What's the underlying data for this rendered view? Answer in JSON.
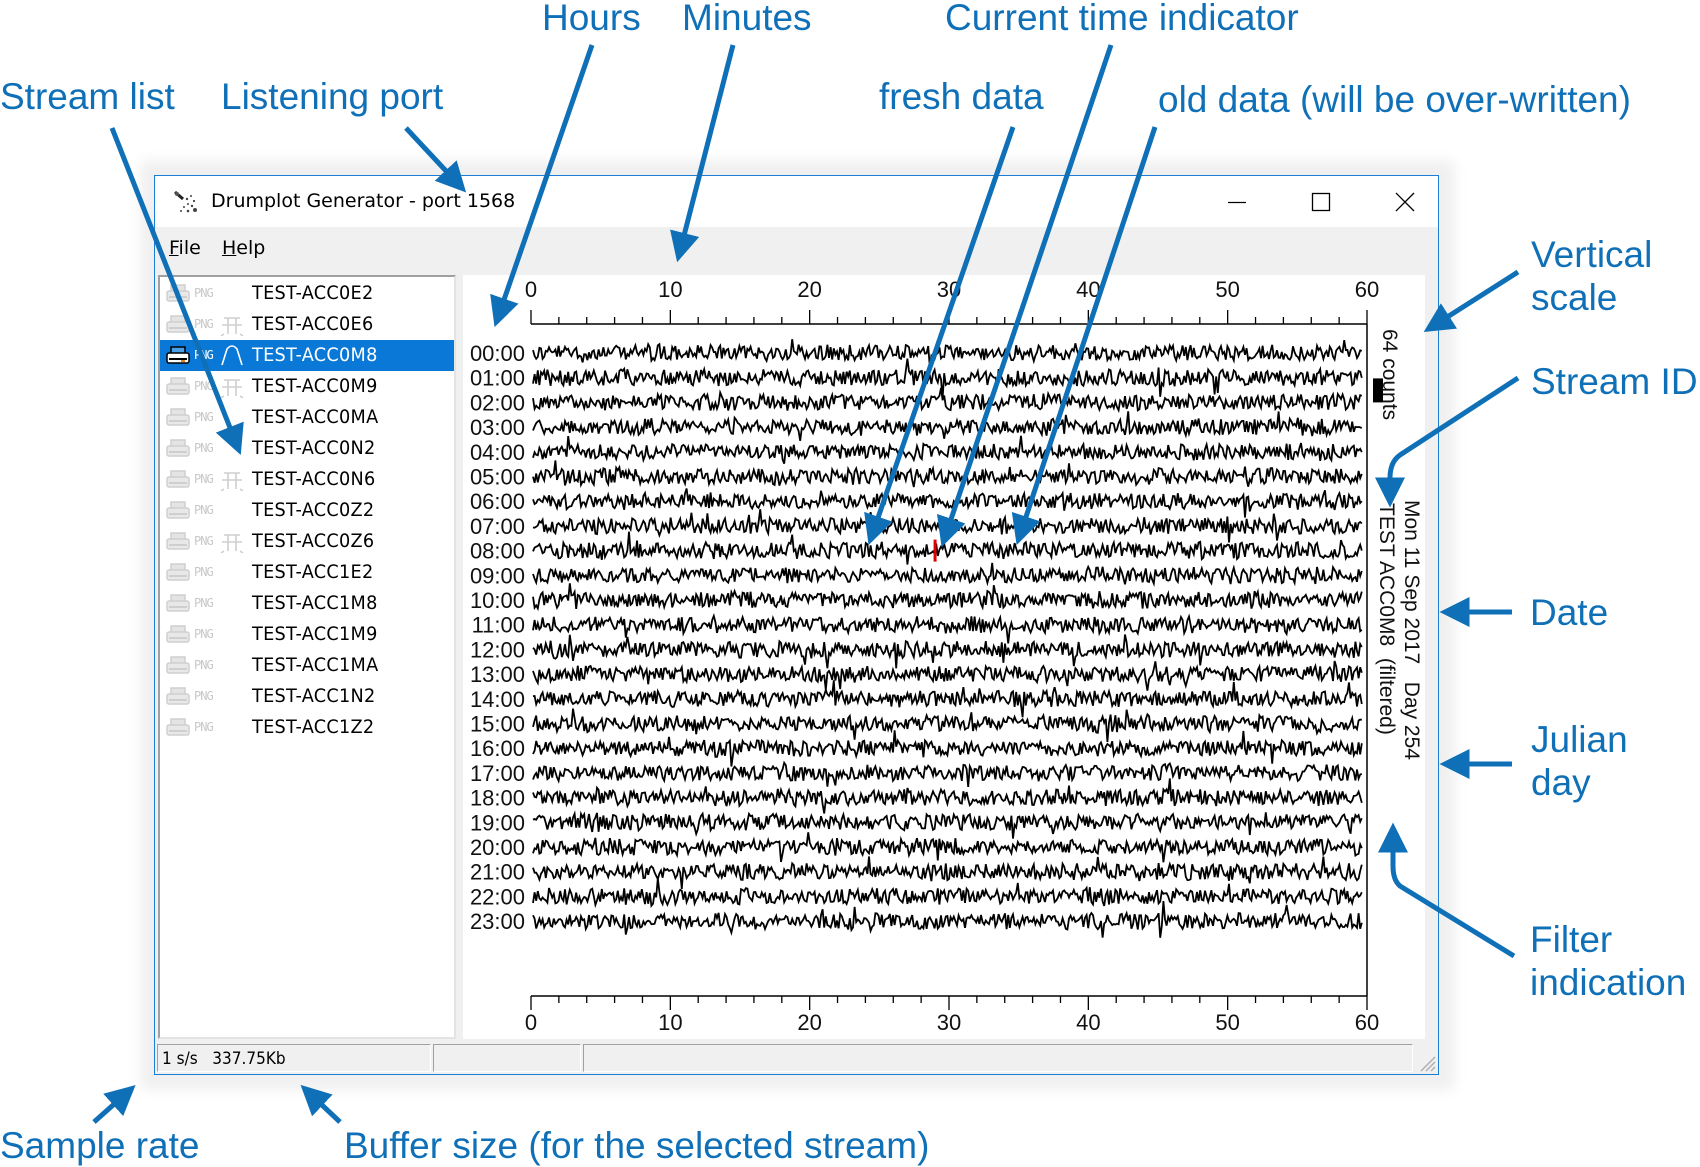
{
  "annotations": {
    "hours": "Hours",
    "minutes": "Minutes",
    "current_time_indicator": "Current time indicator",
    "stream_list": "Stream list",
    "listening_port": "Listening port",
    "fresh_data": "fresh data",
    "old_data": "old data (will be over-written)",
    "vertical_scale_line1": "Vertical",
    "vertical_scale_line2": "scale",
    "stream_id": "Stream ID",
    "date": "Date",
    "julian_day_line1": "Julian",
    "julian_day_line2": "day",
    "filter_indication_line1": "Filter",
    "filter_indication_line2": "indication",
    "sample_rate": "Sample rate",
    "buffer_size": "Buffer size (for the selected stream)"
  },
  "window": {
    "title": "Drumplot Generator - port 1568",
    "icon": "drumplot-app-icon",
    "controls": {
      "minimize": "minimize-icon",
      "maximize": "maximize-icon",
      "close": "close-icon"
    }
  },
  "menu": [
    {
      "label_mnemonic": "F",
      "label_rest": "ile"
    },
    {
      "label_mnemonic": "H",
      "label_rest": "elp"
    }
  ],
  "streams": [
    {
      "name": "TEST-ACC0E2",
      "png": "PNG",
      "filter": false,
      "selected": false
    },
    {
      "name": "TEST-ACC0E6",
      "png": "PNG",
      "filter": true,
      "selected": false
    },
    {
      "name": "TEST-ACC0M8",
      "png": "PNG",
      "filter": true,
      "selected": true
    },
    {
      "name": "TEST-ACC0M9",
      "png": "PNG",
      "filter": true,
      "selected": false
    },
    {
      "name": "TEST-ACC0MA",
      "png": "PNG",
      "filter": false,
      "selected": false
    },
    {
      "name": "TEST-ACC0N2",
      "png": "PNG",
      "filter": false,
      "selected": false
    },
    {
      "name": "TEST-ACC0N6",
      "png": "PNG",
      "filter": true,
      "selected": false
    },
    {
      "name": "TEST-ACC0Z2",
      "png": "PNG",
      "filter": false,
      "selected": false
    },
    {
      "name": "TEST-ACC0Z6",
      "png": "PNG",
      "filter": true,
      "selected": false
    },
    {
      "name": "TEST-ACC1E2",
      "png": "PNG",
      "filter": false,
      "selected": false
    },
    {
      "name": "TEST-ACC1M8",
      "png": "PNG",
      "filter": false,
      "selected": false
    },
    {
      "name": "TEST-ACC1M9",
      "png": "PNG",
      "filter": false,
      "selected": false
    },
    {
      "name": "TEST-ACC1MA",
      "png": "PNG",
      "filter": false,
      "selected": false
    },
    {
      "name": "TEST-ACC1N2",
      "png": "PNG",
      "filter": false,
      "selected": false
    },
    {
      "name": "TEST-ACC1Z2",
      "png": "PNG",
      "filter": false,
      "selected": false
    }
  ],
  "drumplot": {
    "x_ticks": [
      "0",
      "10",
      "20",
      "30",
      "40",
      "50",
      "60"
    ],
    "x_range_minutes": [
      0,
      60
    ],
    "minor_tick_step_minutes": 2,
    "hour_labels": [
      "00:00",
      "01:00",
      "02:00",
      "03:00",
      "04:00",
      "05:00",
      "06:00",
      "07:00",
      "08:00",
      "09:00",
      "10:00",
      "11:00",
      "12:00",
      "13:00",
      "14:00",
      "15:00",
      "16:00",
      "17:00",
      "18:00",
      "19:00",
      "20:00",
      "21:00",
      "22:00",
      "23:00"
    ],
    "scale_text": "64 counts",
    "date_text": "Mon 11 Sep 2017   Day 254",
    "stream_id_text": "TEST ACC0M8  (filtered)",
    "current_time": {
      "hour": 8,
      "minute": 29
    },
    "indicator_color": "#e00000",
    "trace_color": "#000000"
  },
  "statusbar": {
    "sample_rate": "1 s/s",
    "buffer_size": "337.75Kb",
    "panel2": "",
    "panel3": ""
  },
  "colors": {
    "accent": "#0f70b7",
    "selection": "#0a78d7",
    "window_border": "#1a7fd4"
  }
}
